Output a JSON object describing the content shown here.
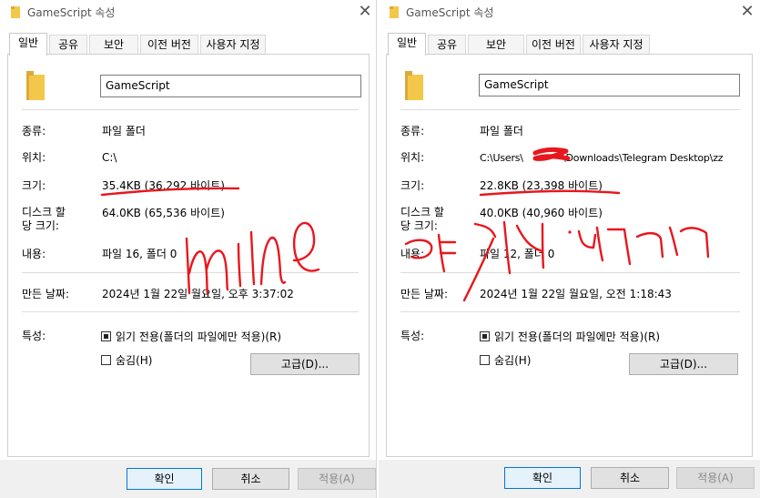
{
  "windows": [
    {
      "title": "GameScript 속성",
      "tabs": [
        "일반",
        "공유",
        "보안",
        "이전 버전",
        "사용자 지정"
      ],
      "name_value": "GameScript",
      "fields": {
        "type_label": "종류:",
        "type_value": "파일 폴더",
        "location_label": "위치:",
        "location_value": "C:\\",
        "size_label": "크기:",
        "size_value": "35.4KB (36,292 바이트)",
        "disk_label_1": "디스크 할",
        "disk_label_2": "당 크기:",
        "disk_value": "64.0KB (65,536 바이트)",
        "contents_label": "내용:",
        "contents_value": "파일 16, 폴더 0",
        "created_label": "만든 날짜:",
        "created_value": "2024년 1월 22일 월요일, 오후 3:37:02",
        "attributes_label": "특성:",
        "readonly_label": "읽기 전용(폴더의 파일에만 적용)(R)",
        "hidden_label": "숨김(H)",
        "advanced_label": "고급(D)..."
      },
      "buttons": {
        "ok": "확인",
        "cancel": "취소",
        "apply": "적용(A)"
      },
      "annotation_text": "mine"
    },
    {
      "title": "GameScript 속성",
      "tabs": [
        "일반",
        "공유",
        "보안",
        "이전 버전",
        "사용자 지정"
      ],
      "name_value": "GameScript",
      "fields": {
        "type_label": "종류:",
        "type_value": "파일 폴더",
        "location_label": "위치:",
        "location_value_start": "C:\\Users\\",
        "location_value_end": "\\Downloads\\Telegram Desktop\\zz",
        "size_label": "크기:",
        "size_value": "22.8KB (23,398 바이트)",
        "disk_label_1": "디스크 할",
        "disk_label_2": "당 크기:",
        "disk_value": "40.0KB (40,960 바이트)",
        "contents_label": "내용:",
        "contents_value": "파일 12, 폴더 0",
        "created_label": "만든 날짜:",
        "created_value": "2024년 1월 22일 월요일, 오전 1:18:43",
        "attributes_label": "특성:",
        "readonly_label": "읽기 전용(폴더의 파일에만 적용)(R)",
        "hidden_label": "숨김(H)",
        "advanced_label": "고급(D)..."
      },
      "buttons": {
        "ok": "확인",
        "cancel": "취소",
        "apply": "적용(A)"
      },
      "annotation_text": "여기서 받은거"
    }
  ],
  "colors": {
    "annotation": "#e8171d",
    "folder_yellow": "#f3c84a",
    "folder_dark": "#dca93a",
    "redaction": "#e8171d"
  },
  "icons": [
    "folder-icon",
    "close-icon"
  ]
}
